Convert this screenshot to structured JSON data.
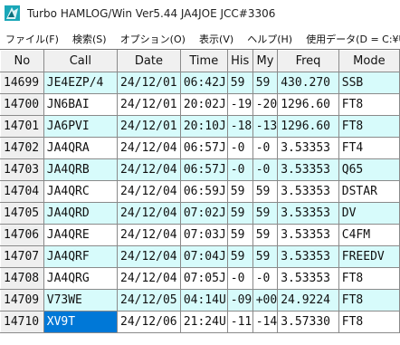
{
  "window": {
    "title": "Turbo HAMLOG/Win Ver5.44 JA4JOE JCC#3306",
    "icon": "hamlog-app-icon"
  },
  "menu": [
    {
      "label": "ファイル(F)"
    },
    {
      "label": "検索(S)"
    },
    {
      "label": "オプション(O)"
    },
    {
      "label": "表示(V)"
    },
    {
      "label": "ヘルプ(H)"
    },
    {
      "label": "使用データ(D = C:¥Users¥t"
    }
  ],
  "grid": {
    "headers": [
      "No",
      "Call",
      "Date",
      "Time",
      "His",
      "My",
      "Freq",
      "Mode"
    ],
    "rows": [
      {
        "no": "14699",
        "call": "JE4EZP/4",
        "date": "24/12/01",
        "time": "06:42J",
        "his": "59",
        "my": "59",
        "freq": "430.270",
        "mode": "SSB",
        "style": "cyan"
      },
      {
        "no": "14700",
        "call": "JN6BAI",
        "date": "24/12/01",
        "time": "20:02J",
        "his": "-19",
        "my": "-20",
        "freq": "1296.60",
        "mode": "FT8",
        "style": "white"
      },
      {
        "no": "14701",
        "call": "JA6PVI",
        "date": "24/12/01",
        "time": "20:10J",
        "his": "-18",
        "my": "-13",
        "freq": "1296.60",
        "mode": "FT8",
        "style": "cyan"
      },
      {
        "no": "14702",
        "call": "JA4QRA",
        "date": "24/12/04",
        "time": "06:57J",
        "his": "-0",
        "my": "-0",
        "freq": "3.53353",
        "mode": "FT4",
        "style": "white"
      },
      {
        "no": "14703",
        "call": "JA4QRB",
        "date": "24/12/04",
        "time": "06:57J",
        "his": "-0",
        "my": "-0",
        "freq": "3.53353",
        "mode": "Q65",
        "style": "cyan"
      },
      {
        "no": "14704",
        "call": "JA4QRC",
        "date": "24/12/04",
        "time": "06:59J",
        "his": "59",
        "my": "59",
        "freq": "3.53353",
        "mode": "DSTAR",
        "style": "white"
      },
      {
        "no": "14705",
        "call": "JA4QRD",
        "date": "24/12/04",
        "time": "07:02J",
        "his": "59",
        "my": "59",
        "freq": "3.53353",
        "mode": "DV",
        "style": "cyan"
      },
      {
        "no": "14706",
        "call": "JA4QRE",
        "date": "24/12/04",
        "time": "07:03J",
        "his": "59",
        "my": "59",
        "freq": "3.53353",
        "mode": "C4FM",
        "style": "white"
      },
      {
        "no": "14707",
        "call": "JA4QRF",
        "date": "24/12/04",
        "time": "07:04J",
        "his": "59",
        "my": "59",
        "freq": "3.53353",
        "mode": "FREEDV",
        "style": "cyan"
      },
      {
        "no": "14708",
        "call": "JA4QRG",
        "date": "24/12/04",
        "time": "07:05J",
        "his": "-0",
        "my": "-0",
        "freq": "3.53353",
        "mode": "FT8",
        "style": "white"
      },
      {
        "no": "14709",
        "call": "V73WE",
        "date": "24/12/05",
        "time": "04:14U",
        "his": "-09",
        "my": "+00",
        "freq": "24.9224",
        "mode": "FT8",
        "style": "cyan"
      },
      {
        "no": "14710",
        "call": "XV9T",
        "date": "24/12/06",
        "time": "21:24U",
        "his": "-11",
        "my": "-14",
        "freq": "3.57330",
        "mode": "FT8",
        "style": "white",
        "selected": "call"
      }
    ]
  },
  "colors": {
    "row_alt": "#d7fbfb",
    "selection": "#0078d7"
  }
}
